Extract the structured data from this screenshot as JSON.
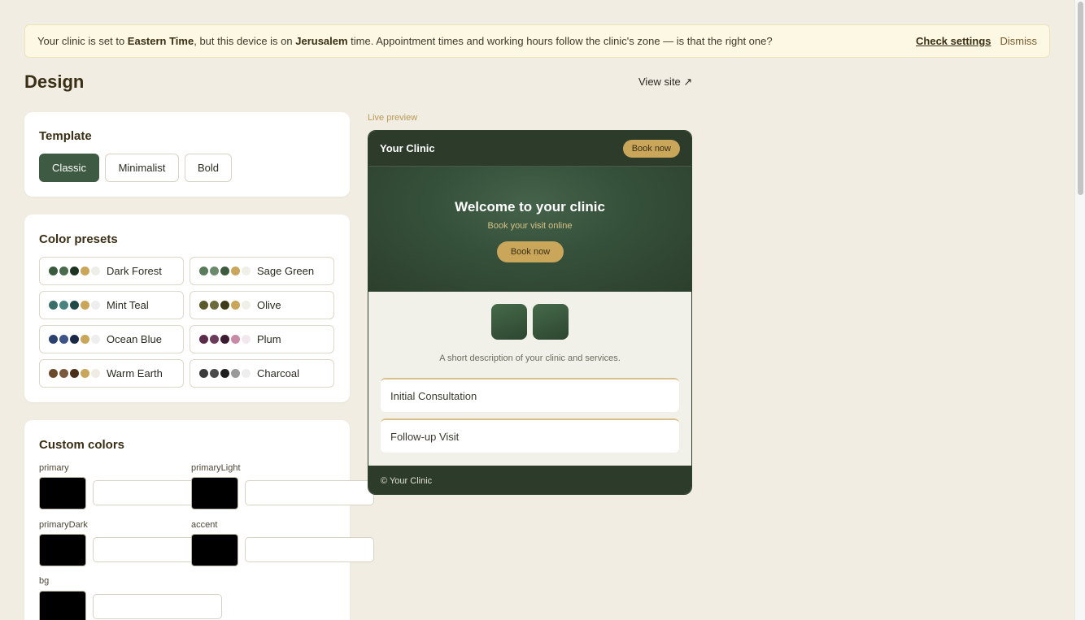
{
  "banner": {
    "text_1": "Your clinic is set to ",
    "clinic_zone": "Eastern Time",
    "text_2": ", but this device is on ",
    "device_zone": "Jerusalem",
    "text_3": " time. Appointment times and working hours follow the clinic's zone — is that the right one?",
    "check_label": "Check settings",
    "dismiss_label": "Dismiss"
  },
  "page": {
    "title": "Design",
    "view_site": "View site ↗"
  },
  "template": {
    "heading": "Template",
    "options": [
      "Classic",
      "Minimalist",
      "Bold"
    ],
    "selected": "Classic"
  },
  "presets": {
    "heading": "Color presets",
    "items": [
      {
        "label": "Dark Forest",
        "colors": [
          "#3a5a3e",
          "#4a6a4c",
          "#1f3322",
          "#c9a65a",
          "#eeeee8"
        ]
      },
      {
        "label": "Sage Green",
        "colors": [
          "#5a7a5c",
          "#6b8a6c",
          "#3c5a3e",
          "#c9a65a",
          "#f0efe8"
        ]
      },
      {
        "label": "Mint Teal",
        "colors": [
          "#3a6e6a",
          "#4a8280",
          "#1f4a48",
          "#c9a65a",
          "#eeeeee"
        ]
      },
      {
        "label": "Olive",
        "colors": [
          "#5a5a2c",
          "#6b6b3c",
          "#3c3c1a",
          "#c9a65a",
          "#f0efe8"
        ]
      },
      {
        "label": "Ocean Blue",
        "colors": [
          "#2c4070",
          "#3c5488",
          "#1a2848",
          "#c9a65a",
          "#eeeeee"
        ]
      },
      {
        "label": "Plum",
        "colors": [
          "#5a2c4a",
          "#6b3c5a",
          "#3c1a30",
          "#c98aa6",
          "#f0e8ec"
        ]
      },
      {
        "label": "Warm Earth",
        "colors": [
          "#6b4a2c",
          "#7a5a3c",
          "#4a301a",
          "#c9a65a",
          "#f0ece4"
        ]
      },
      {
        "label": "Charcoal",
        "colors": [
          "#3a3a3a",
          "#4a4a4a",
          "#1f1f1f",
          "#9a9a9a",
          "#eeeeee"
        ]
      }
    ]
  },
  "custom_colors": {
    "heading": "Custom colors",
    "fields": [
      {
        "label": "primary",
        "value": ""
      },
      {
        "label": "primaryLight",
        "value": ""
      },
      {
        "label": "primaryDark",
        "value": ""
      },
      {
        "label": "accent",
        "value": ""
      },
      {
        "label": "bg",
        "value": ""
      }
    ]
  },
  "preview": {
    "label": "Live preview",
    "brand": "Your Clinic",
    "nav_button": "Book now",
    "hero_title": "Welcome to your clinic",
    "hero_sub": "Book your visit online",
    "hero_button": "Book now",
    "description": "A short description of your clinic and services.",
    "services": [
      "Initial Consultation",
      "Follow-up Visit"
    ],
    "footer": "© Your Clinic"
  },
  "colors": {
    "primary": "#3e5a42",
    "accent": "#c9a65a",
    "background": "#f1ede3"
  }
}
